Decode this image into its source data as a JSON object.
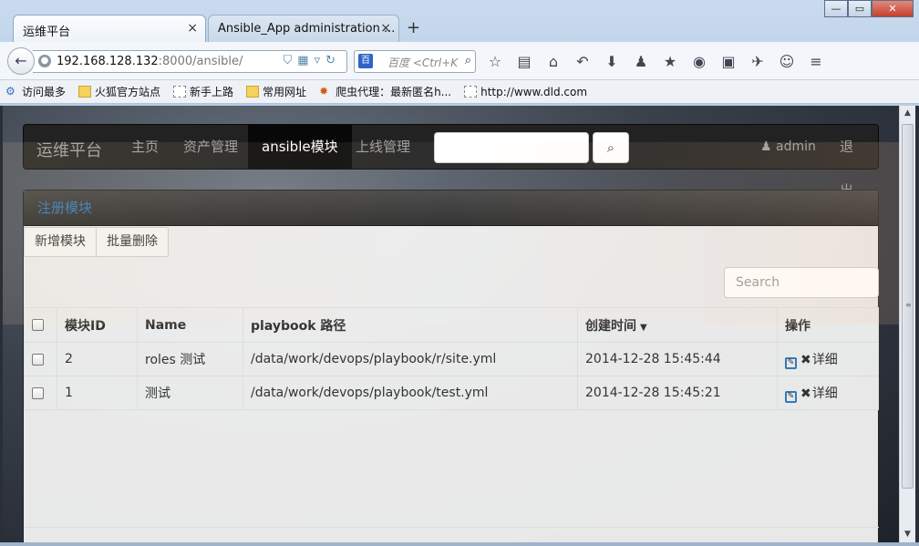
{
  "browser": {
    "tabs": [
      {
        "label": "运维平台",
        "close": "×"
      },
      {
        "label": "Ansible_App administration ...",
        "close": "×"
      }
    ],
    "new_tab": "+",
    "window": {
      "minimize": "—",
      "maximize": "▭",
      "close": "✕"
    },
    "url": {
      "host": "192.168.128.132",
      "rest": ":8000/ansible/"
    },
    "search_placeholder": "百度 <Ctrl+K",
    "bookmarks": [
      "访问最多",
      "火狐官方站点",
      "新手上路",
      "常用网址",
      "爬虫代理：最新匿名h...",
      "http://www.dld.com"
    ]
  },
  "app_nav": {
    "brand": "运维平台",
    "items": [
      "主页",
      "资产管理",
      "ansible模块",
      "上线管理"
    ],
    "active_index": 2,
    "search_value": "",
    "user": "admin",
    "logout": "退出"
  },
  "panel": {
    "title": "注册模块",
    "buttons": {
      "add": "新增模块",
      "batch_delete": "批量删除"
    },
    "search_placeholder": "Search",
    "table": {
      "headers": [
        "模块ID",
        "Name",
        "playbook 路径",
        "创建时间",
        "操作"
      ],
      "rows": [
        {
          "id": "2",
          "name": "roles 测试",
          "path": "/data/work/devops/playbook/r/site.yml",
          "created": "2014-12-28 15:45:44",
          "detail": "详细"
        },
        {
          "id": "1",
          "name": "测试",
          "path": "/data/work/devops/playbook/test.yml",
          "created": "2014-12-28 15:45:21",
          "detail": "详细"
        }
      ]
    }
  },
  "colors": {
    "accent": "#337ab7",
    "navbar": "#222222"
  }
}
